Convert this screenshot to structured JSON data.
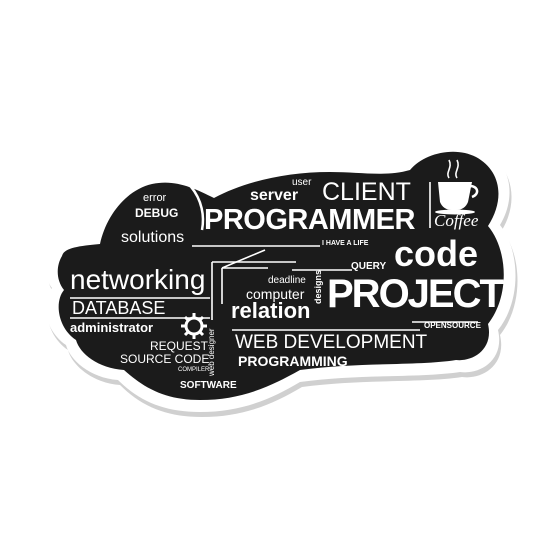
{
  "colors": {
    "sticker_fill": "#1b1b1b",
    "sticker_border": "#ffffff",
    "sticker_shadow": "#c8c8c8",
    "text": "#ffffff",
    "background": "#ffffff"
  },
  "icons": [
    "coffee-cup-icon",
    "gear-icon"
  ],
  "words": {
    "error": "error",
    "debug": "DEBUG",
    "solutions": "solutions",
    "user": "user",
    "server": "server",
    "client": "CLIENT",
    "programmer": "PROGRAMMER",
    "coffee": "Coffee",
    "i_have_a_life": "I HAVE A LIFE",
    "code": "code",
    "networking": "networking",
    "database": "DATABASE",
    "administrator": "administrator",
    "query": "QUERY",
    "deadline": "deadline",
    "computer": "computer",
    "designs": "designs",
    "relation": "relation",
    "project": "PROJECT",
    "opensource": "OPENSOURCE",
    "request": "REQUEST",
    "source_code": "SOURCE CODE",
    "compiler": "COMPILER",
    "web_designer": "web designer",
    "web_development": "WEB DEVELOPMENT",
    "programming": "PROGRAMMING",
    "software": "SOFTWARE"
  }
}
